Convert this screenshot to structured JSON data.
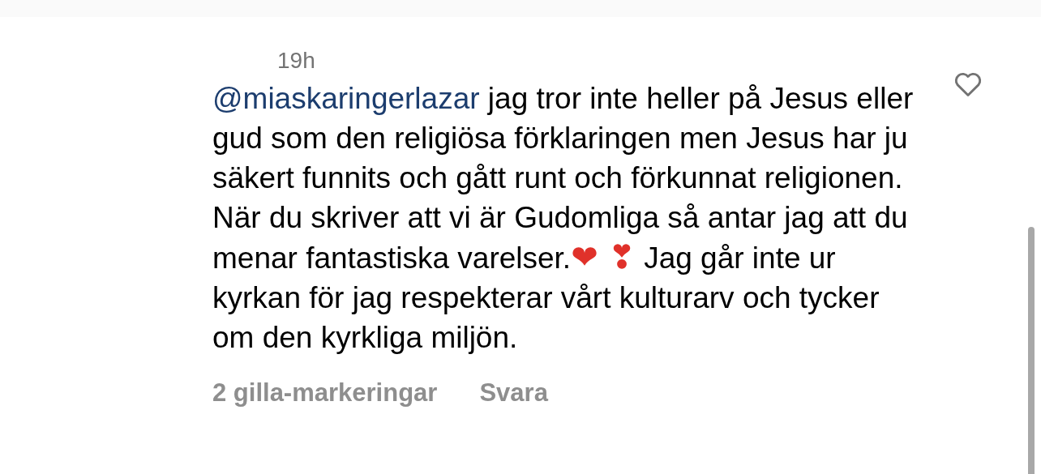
{
  "comment": {
    "time": "19h",
    "segments": [
      {
        "kind": "mention",
        "text": "@miaskaringerlazar"
      },
      {
        "kind": "text",
        "text": " jag tror inte heller på Jesus eller gud som den religiösa förklaringen men Jesus har ju säkert funnits och gått runt och förkunnat religionen. När du skriver att vi är Gudomliga så antar jag att du menar fantastiska varelser."
      },
      {
        "kind": "emoji",
        "text": "❤ ❣"
      },
      {
        "kind": "text",
        "text": " Jag går inte ur kyrkan för jag respekterar vårt kulturarv och tycker om den kyrkliga miljön."
      }
    ],
    "liked": false,
    "likes": "2 gilla-markeringar",
    "reply": "Svara"
  }
}
